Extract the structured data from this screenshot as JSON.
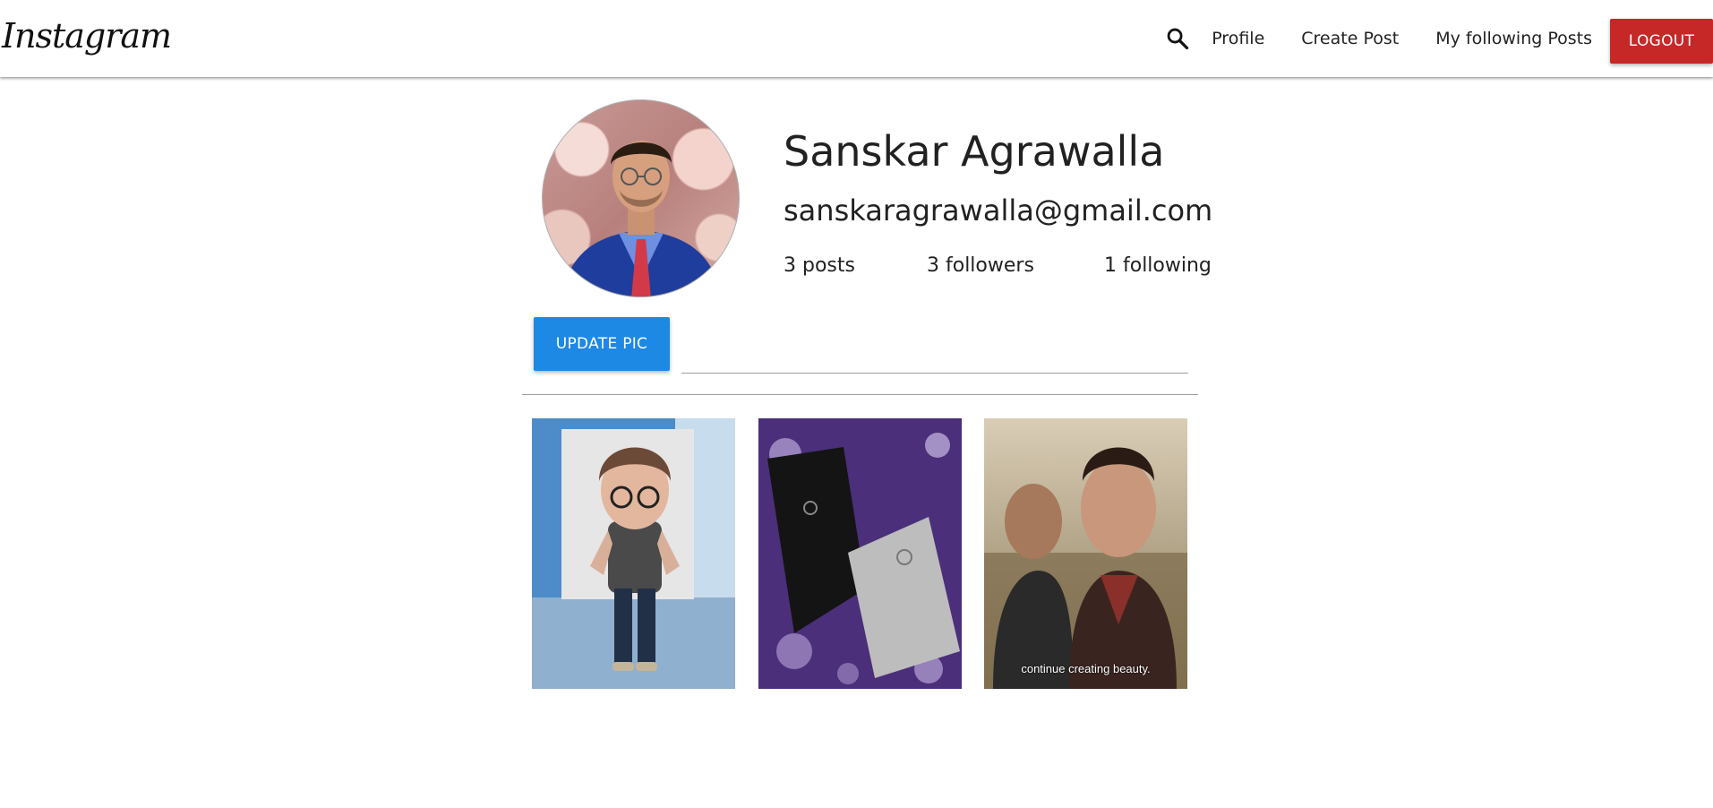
{
  "navbar": {
    "brand": "Instagram",
    "links": [
      {
        "label": "Profile"
      },
      {
        "label": "Create Post"
      },
      {
        "label": "My following Posts"
      }
    ],
    "logout_label": "LOGOUT",
    "search_icon": "search-icon",
    "logout_color": "#c62828"
  },
  "profile": {
    "name": "Sanskar Agrawalla",
    "email": "sanskaragrawalla@gmail.com",
    "posts_stat": "3 posts",
    "followers_stat": "3 followers",
    "following_stat": "1 following"
  },
  "update": {
    "button_label": "UPDATE PIC",
    "button_color": "#1e88e5",
    "file_path_value": ""
  },
  "gallery": {
    "items": [
      {
        "subject": "cartoon avatar with glasses"
      },
      {
        "subject": "two laptops on purple floral cloth"
      },
      {
        "subject": "two men, scene still",
        "caption": "continue creating beauty."
      }
    ]
  }
}
